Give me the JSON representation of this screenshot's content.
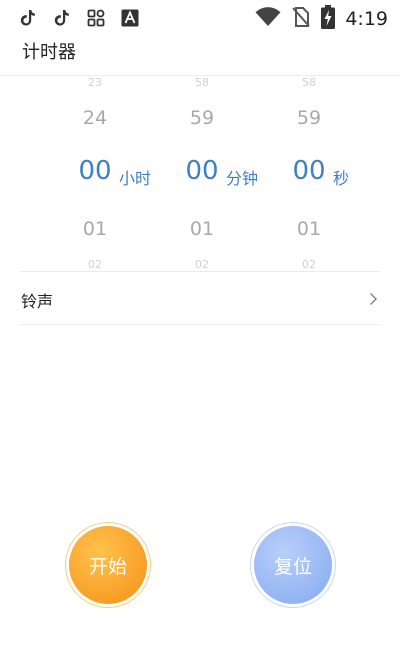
{
  "status_bar": {
    "left_icons": [
      "tiktok-icon",
      "tiktok-icon",
      "apps-grid-icon",
      "font-a-icon"
    ],
    "right_icons": [
      "wifi-icon",
      "no-sim-icon",
      "battery-charging-icon"
    ],
    "time": "4:19"
  },
  "header": {
    "title": "计时器"
  },
  "picker": {
    "hours": {
      "far_above": "23",
      "above": "24",
      "selected": "00",
      "below": "01",
      "far_below": "02",
      "unit": "小时"
    },
    "minutes": {
      "far_above": "58",
      "above": "59",
      "selected": "00",
      "below": "01",
      "far_below": "02",
      "unit": "分钟"
    },
    "seconds": {
      "far_above": "58",
      "above": "59",
      "selected": "00",
      "below": "01",
      "far_below": "02",
      "unit": "秒"
    }
  },
  "ringtone": {
    "label": "铃声"
  },
  "buttons": {
    "start": "开始",
    "reset": "复位"
  },
  "colors": {
    "accent": "#3f7fc3",
    "start_button": "#f79a22",
    "reset_button": "#8fb0f2"
  }
}
